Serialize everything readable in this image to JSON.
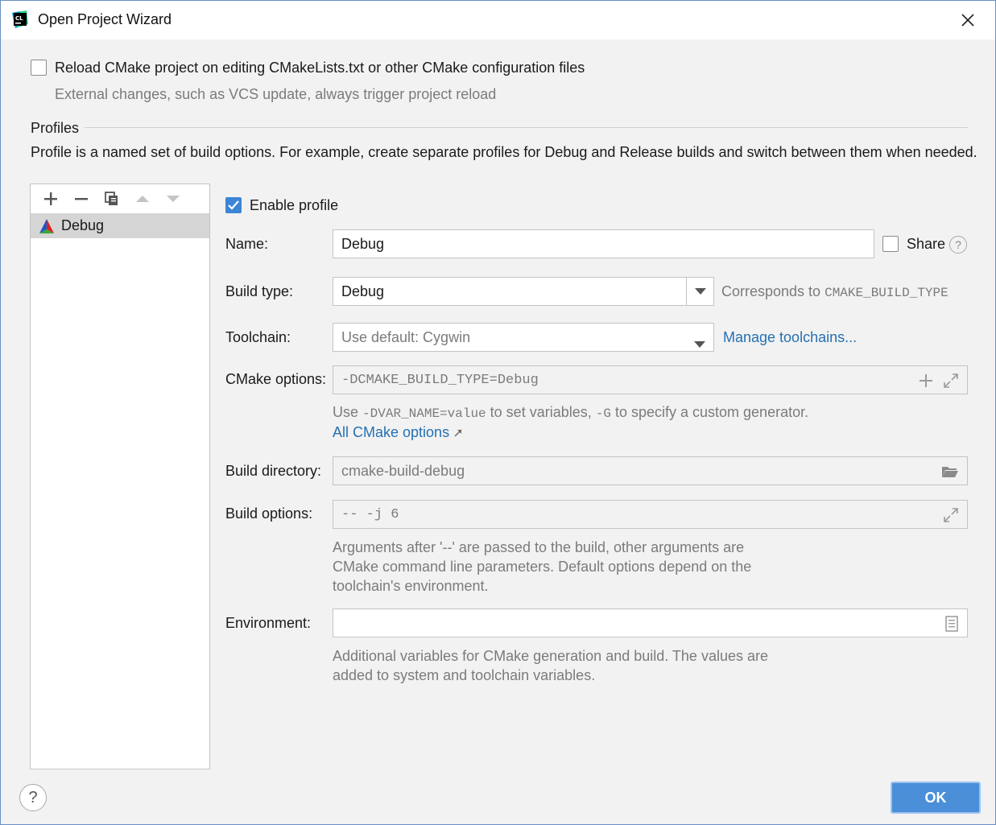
{
  "window": {
    "title": "Open Project Wizard"
  },
  "reload": {
    "label": "Reload CMake project on editing CMakeLists.txt or other CMake configuration files",
    "checked": false,
    "hint": "External changes, such as VCS update, always trigger project reload"
  },
  "profiles": {
    "section_title": "Profiles",
    "description": "Profile is a named set of build options. For example, create separate profiles for Debug and Release builds and switch between them when needed.",
    "items": [
      {
        "label": "Debug",
        "selected": true
      }
    ]
  },
  "form": {
    "enable_label": "Enable profile",
    "enable_checked": true,
    "name_label": "Name:",
    "name_value": "Debug",
    "share_label": "Share",
    "build_type_label": "Build type:",
    "build_type_value": "Debug",
    "corresponds_prefix": "Corresponds to",
    "corresponds_var": "CMAKE_BUILD_TYPE",
    "toolchain_label": "Toolchain:",
    "toolchain_value": "Use default: Cygwin",
    "manage_toolchains": "Manage toolchains...",
    "cmake_options_label": "CMake options:",
    "cmake_options_value": "-DCMAKE_BUILD_TYPE=Debug",
    "cmake_hint_use": "Use",
    "cmake_hint_var": "-DVAR_NAME=value",
    "cmake_hint_mid": "to set variables,",
    "cmake_hint_g": "-G",
    "cmake_hint_end": "to specify a custom generator.",
    "all_cmake_options": "All CMake options",
    "build_dir_label": "Build directory:",
    "build_dir_value": "cmake-build-debug",
    "build_options_label": "Build options:",
    "build_options_value": "-- -j 6",
    "build_options_hint_1": "Arguments after '--' are passed to the build, other arguments are",
    "build_options_hint_2": "CMake command line parameters. Default options depend on the",
    "build_options_hint_3": "toolchain's environment.",
    "environment_label": "Environment:",
    "environment_value": "",
    "environment_hint_1": "Additional variables for CMake generation and build. The values are",
    "environment_hint_2": "added to system and toolchain variables."
  },
  "buttons": {
    "ok": "OK",
    "help": "?"
  },
  "colors": {
    "accent": "#3c85d6",
    "link": "#2470b3",
    "ok_button": "#4a8fd8"
  }
}
